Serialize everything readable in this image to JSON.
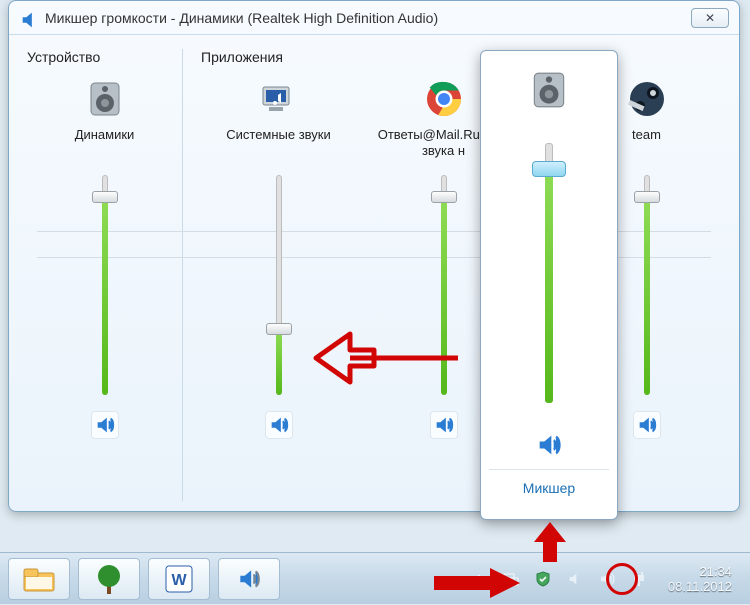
{
  "window": {
    "title": "Микшер громкости - Динамики (Realtek High Definition Audio)",
    "close_glyph": "✕"
  },
  "sections": {
    "device_heading": "Устройство",
    "apps_heading": "Приложения"
  },
  "device": {
    "label": "Динамики",
    "volume_pct": 90
  },
  "apps": [
    {
      "label": "Системные звуки",
      "volume_pct": 30
    },
    {
      "label": "Ответы@Mail.Ru: Нет звука н",
      "volume_pct": 90
    },
    {
      "label": "team",
      "volume_pct": 90
    }
  ],
  "flyout": {
    "volume_pct": 90,
    "mixer_link": "Микшер"
  },
  "taskbar": {
    "tray_icons": [
      "expand",
      "network",
      "defender",
      "sound",
      "volume",
      "power"
    ],
    "clock_time": "21:34",
    "clock_date": "08.11.2012"
  }
}
